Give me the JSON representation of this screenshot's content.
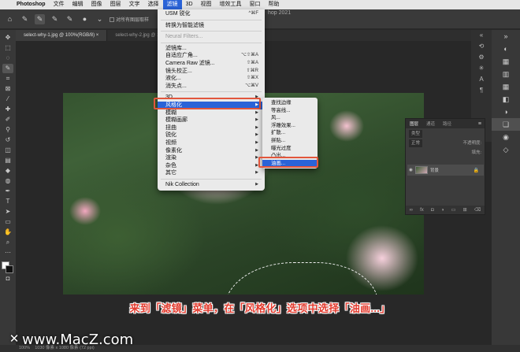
{
  "menubar": {
    "app": "Photoshop",
    "items": [
      "文件",
      "编辑",
      "图像",
      "图层",
      "文字",
      "选择",
      "滤镜",
      "3D",
      "视图",
      "增效工具",
      "窗口",
      "帮助"
    ],
    "active_index": 6
  },
  "window_title": "hop 2021",
  "optionsbar": {
    "sample_all_layers": "对所有图层取样"
  },
  "tabs": [
    {
      "label": "select-why-1.jpg @ 100%(RGB/8)",
      "close": "×"
    },
    {
      "label": "select-why-2.jpg @ 100%(RGB/8) ×",
      "close": ""
    }
  ],
  "filter_menu": {
    "items": [
      {
        "label": "USM 锐化",
        "shortcut": "^⌘F"
      },
      {
        "sep": true
      },
      {
        "label": "转换为智能滤镜"
      },
      {
        "sep": true
      },
      {
        "label": "Neural Filters...",
        "disabled": true
      },
      {
        "sep": true
      },
      {
        "label": "滤镜库..."
      },
      {
        "label": "自适应广角...",
        "shortcut": "⌥⇧⌘A"
      },
      {
        "label": "Camera Raw 滤镜...",
        "shortcut": "⇧⌘A"
      },
      {
        "label": "镜头校正...",
        "shortcut": "⇧⌘R"
      },
      {
        "label": "液化...",
        "shortcut": "⇧⌘X"
      },
      {
        "label": "消失点...",
        "shortcut": "⌥⌘V"
      },
      {
        "sep": true
      },
      {
        "label": "3D",
        "submenu": true
      },
      {
        "label": "风格化",
        "submenu": true,
        "highlighted": true
      },
      {
        "label": "模糊",
        "submenu": true
      },
      {
        "label": "模糊画廊",
        "submenu": true
      },
      {
        "label": "扭曲",
        "submenu": true
      },
      {
        "label": "锐化",
        "submenu": true
      },
      {
        "label": "视频",
        "submenu": true
      },
      {
        "label": "像素化",
        "submenu": true
      },
      {
        "label": "渲染",
        "submenu": true
      },
      {
        "label": "杂色",
        "submenu": true
      },
      {
        "label": "其它",
        "submenu": true
      },
      {
        "sep": true
      },
      {
        "label": "Nik Collection",
        "submenu": true
      }
    ]
  },
  "stylize_submenu": {
    "items": [
      {
        "label": "查找边缘"
      },
      {
        "label": "等高线..."
      },
      {
        "label": "风..."
      },
      {
        "label": "浮雕效果..."
      },
      {
        "label": "扩散..."
      },
      {
        "label": "拼贴..."
      },
      {
        "label": "曝光过度"
      },
      {
        "label": "凸出..."
      },
      {
        "label": "油画...",
        "highlighted": true
      }
    ]
  },
  "layers_panel": {
    "tabs": [
      "图层",
      "通道",
      "路径"
    ],
    "kind_filter": "类型",
    "blend_mode": "正常",
    "opacity_label": "不透明度:",
    "fill_label": "填充:",
    "layer_name": "背景"
  },
  "status": {
    "zoom": "100%",
    "doc_info": "1030 像素 x 1080 像素 (72 ppi)"
  },
  "caption": "来到「滤镜」菜单，在「风格化」选项中选择「油画...」",
  "watermark": "www.MacZ.com",
  "colors": {
    "menu_highlight": "#2a63d8",
    "callout_box": "#e2563c",
    "caption_text": "#e23b2e"
  }
}
